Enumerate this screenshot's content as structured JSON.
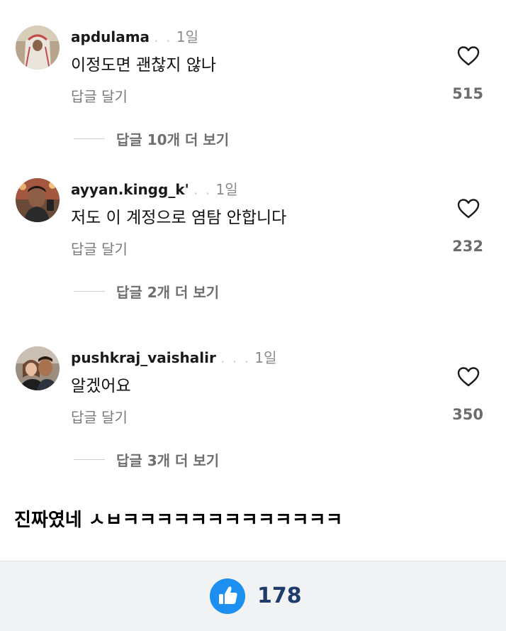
{
  "comments": [
    {
      "username": "apdulama",
      "username_faded": ". .",
      "time": "1일",
      "text": "이정도면 괜찮지 않나",
      "reply_label": "답글 달기",
      "likes": "515",
      "view_replies": "답글 10개 더 보기"
    },
    {
      "username": "ayyan.kingg_k'",
      "username_faded": ". .",
      "time": "1일",
      "text": "저도 이 계정으로 염탐 안합니다",
      "reply_label": "답글 달기",
      "likes": "232",
      "view_replies": "답글 2개 더 보기"
    },
    {
      "username": "pushkraj_vaishalir",
      "username_faded": ". . .",
      "time": "1일",
      "text": "알겠어요",
      "reply_label": "답글 달기",
      "likes": "350",
      "view_replies": "답글 3개 더 보기"
    }
  ],
  "caption": "진짜였네 ㅅㅂㅋㅋㅋㅋㅋㅋㅋㅋㅋㅋㅋㅋㅋ",
  "bottom_bar": {
    "like_count": "178",
    "like_color": "#1d8ff0"
  },
  "icons": {
    "comment_like": "heart-outline-icon",
    "post_like": "thumbs-up-icon"
  }
}
